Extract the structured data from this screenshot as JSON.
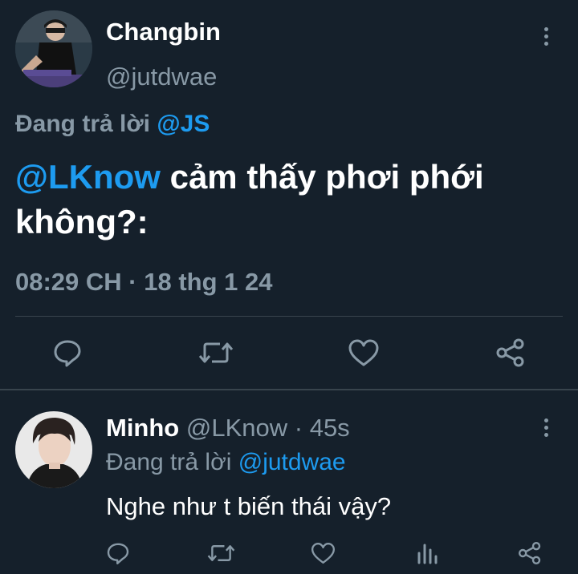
{
  "main_tweet": {
    "author_name": "Changbin",
    "author_handle": "@jutdwae",
    "replying_prefix": "Đang trả lời",
    "replying_to": "@JS",
    "mention": "@LKnow",
    "body_text": " cảm thấy phơi phới không?:",
    "timestamp": "08:29 CH · 18 thg 1 24",
    "actions": [
      "reply-icon",
      "retweet-icon",
      "like-icon",
      "share-icon"
    ]
  },
  "reply_tweet": {
    "author_name": "Minho",
    "author_handle": "@LKnow",
    "meta": "· 45s",
    "replying_prefix": "Đang trả lời",
    "replying_to": "@jutdwae",
    "body_text": "Nghe như t biến thái vậy?",
    "actions": [
      "reply-icon",
      "retweet-icon",
      "like-icon",
      "analytics-icon",
      "share-icon"
    ]
  },
  "colors": {
    "background": "#15202b",
    "accent": "#1d9bf0",
    "muted": "#8899a6",
    "divider": "#38444d"
  }
}
